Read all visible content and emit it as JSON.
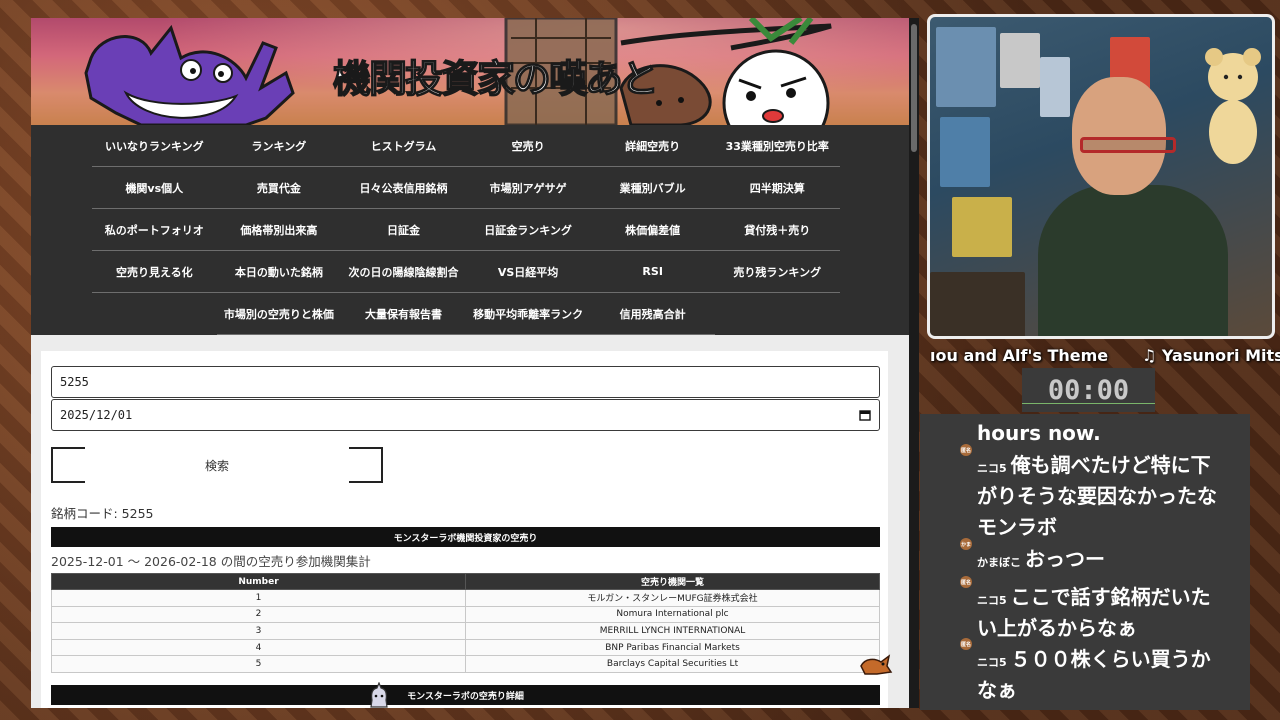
{
  "site": {
    "title": "機関投資家の嘆あと",
    "nav": [
      [
        "いいなりランキング",
        "ランキング",
        "ヒストグラム",
        "空売り",
        "詳細空売り",
        "33業種別空売り比率"
      ],
      [
        "機関vs個人",
        "売買代金",
        "日々公表信用銘柄",
        "市場別アゲサゲ",
        "業種別バブル",
        "四半期決算"
      ],
      [
        "私のポートフォリオ",
        "価格帯別出来高",
        "日証金",
        "日証金ランキング",
        "株価偏差値",
        "貸付残＋売り"
      ],
      [
        "空売り見える化",
        "本日の動いた銘柄",
        "次の日の陽線陰線割合",
        "VS日経平均",
        "RSI",
        "売り残ランキング"
      ],
      [
        "市場別の空売りと株価",
        "大量保有報告書",
        "移動平均乖離率ランク",
        "信用残高合計"
      ]
    ]
  },
  "form": {
    "code_value": "5255",
    "date_value": "2025/12/01",
    "calendar_icon": "calendar-icon",
    "search_label": "検索"
  },
  "result": {
    "code_line": "銘柄コード: 5255",
    "section1_title": "モンスターラボ機関投資家の空売り",
    "range_line": "2025-12-01 ～ 2026-02-18 の間の空売り参加機関集計",
    "table": {
      "headers": [
        "Number",
        "空売り機関一覧"
      ],
      "rows": [
        [
          "1",
          "モルガン・スタンレーMUFG証券株式会社"
        ],
        [
          "2",
          "Nomura International plc"
        ],
        [
          "3",
          "MERRILL LYNCH INTERNATIONAL"
        ],
        [
          "4",
          "BNP Paribas Financial Markets"
        ],
        [
          "5",
          "Barclays Capital Securities Lt"
        ]
      ]
    },
    "section2_title": "モンスターラボの空売り詳細"
  },
  "stream": {
    "ticker_a": "ıou and Alf's Theme",
    "ticker_b": "♫ Yasunori Mits",
    "timer": "00:00",
    "chat": [
      {
        "user": "",
        "lines": [
          "hours now."
        ]
      },
      {
        "user": "ニコ5",
        "badge": "匿名",
        "lines": [
          "俺も調べたけど特に下",
          "がりそうな要因なかったな",
          "モンラボ"
        ]
      },
      {
        "user": "かまぼこ",
        "badge": "かま",
        "lines": [
          "おっつー"
        ]
      },
      {
        "user": "ニコ5",
        "badge": "匿名",
        "lines": [
          "ここで話す銘柄だいた",
          "い上がるからなぁ"
        ]
      },
      {
        "user": "ニコ5",
        "badge": "匿名",
        "lines": [
          "５００株くらい買うか",
          "なぁ"
        ]
      }
    ],
    "colors": {
      "accent": "#7ab56a",
      "glasses": "#b42a2a"
    }
  }
}
